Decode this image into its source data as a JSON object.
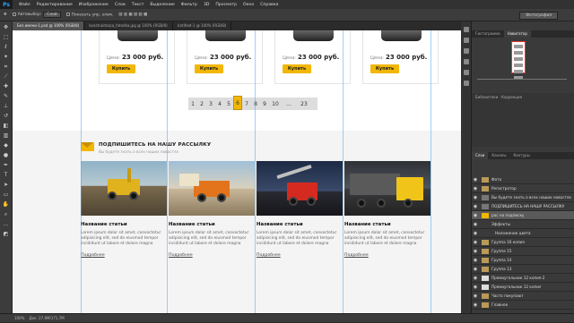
{
  "app": {
    "logo": "Ps",
    "menu": [
      "Файл",
      "Редактирование",
      "Изображение",
      "Слои",
      "Текст",
      "Выделение",
      "Фильтр",
      "3D",
      "Просмотр",
      "Окно",
      "Справка"
    ]
  },
  "options": {
    "autoselect": "Автовыбор:",
    "layer_select": "Слой",
    "show_controls": "Показать упр. элем.",
    "workspace": "Фотография"
  },
  "doc_tabs": [
    {
      "label": "Без имени-1.psd @ 100% (RGB/8)",
      "active": true
    },
    {
      "label": "konstruktorpa_fotodka.jpg @ 100% (RGB/8)",
      "active": false
    },
    {
      "label": "Untitled-1 @ 100% (RGB/8)",
      "active": false
    }
  ],
  "products": [
    {
      "price_label": "Цена:",
      "price": "23 000 руб.",
      "buy": "Купить"
    },
    {
      "price_label": "Цена:",
      "price": "23 000 руб.",
      "buy": "Купить"
    },
    {
      "price_label": "Цена:",
      "price": "23 000 руб.",
      "buy": "Купить"
    },
    {
      "price_label": "Цена:",
      "price": "23 000 руб.",
      "buy": "Купить"
    }
  ],
  "pagination": {
    "pages": [
      "1",
      "2",
      "3",
      "4",
      "5",
      "6",
      "7",
      "8",
      "9",
      "10",
      "...",
      "23"
    ],
    "current": "6"
  },
  "subscribe": {
    "title": "ПОДПИШИТЕСЬ НА НАШУ РАССЫЛКУ",
    "subtitle": "Вы будете знать о всех наших новостях"
  },
  "articles": [
    {
      "title": "Название статьи",
      "text": "Lorem ipsum dolor sit amet, consectetur adipisicing elit, sed do eiusmod tempor incididunt ut labore et dolore magna",
      "link": "Подробнее"
    },
    {
      "title": "Название статьи",
      "text": "Lorem ipsum dolor sit amet, consectetur adipisicing elit, sed do eiusmod tempor incididunt ut labore et dolore magna",
      "link": "Подробнее"
    },
    {
      "title": "Название статьи",
      "text": "Lorem ipsum dolor sit amet, consectetur adipisicing elit, sed do eiusmod tempor incididunt ut labore et dolore magna",
      "link": "Подробнее"
    },
    {
      "title": "Название статьи",
      "text": "Lorem ipsum dolor sit amet, consectetur adipisicing elit, sed do eiusmod tempor incididunt ut labore et dolore magna",
      "link": "Подробнее"
    }
  ],
  "panel": {
    "tabs": [
      "Гистограмма",
      "Навигатор"
    ],
    "library_tabs": [
      "Библиотеки",
      "Коррекция"
    ],
    "layer_tabs": [
      "Слои",
      "Каналы",
      "Контуры"
    ],
    "layers": [
      "Фото",
      "Регистратор",
      "Вы будете знать о всех наших новостях",
      "ПОДПИШИТЕСЬ НА НАШУ РАССЫЛКУ",
      "рас на подписку",
      "Эффекты",
      "Наложение цвета",
      "Группа 16 копия",
      "Группа 15",
      "Группа 14",
      "Группа 13",
      "Прямоугольник 12 копия 2",
      "Прямоугольник 12 копия",
      "Часто покупают",
      "Главное"
    ]
  },
  "status": {
    "zoom": "100%",
    "doc": "Док: 27,9M/171,7M"
  },
  "colors": {
    "accent": "#f2b705",
    "ps_bg": "#282828",
    "panel": "#3a3a3a"
  }
}
